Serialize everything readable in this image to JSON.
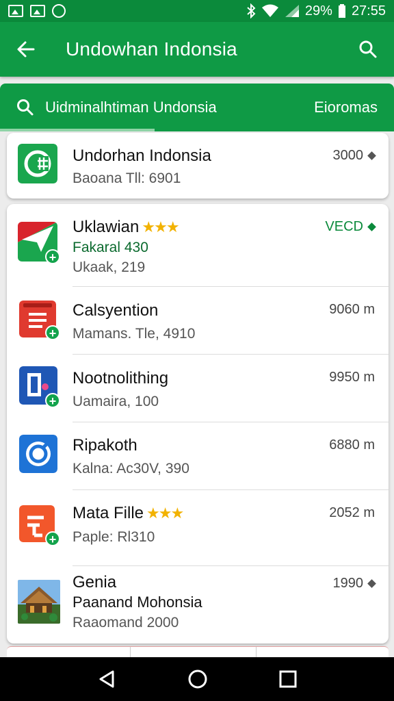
{
  "status_bar": {
    "battery_percent": "29%",
    "time": "27:55"
  },
  "app_bar": {
    "title": "Undowhan Indonsia"
  },
  "tabs": {
    "search_label": "Uidminalhtiman Undonsia",
    "right_label": "Eioromas"
  },
  "featured": {
    "title": "Undorhan Indonsia",
    "subtitle": "Baoana Tll: 6901",
    "value": "3000"
  },
  "items": [
    {
      "title": "Uklawian",
      "subtitle": "Fakaral 430",
      "subtitle2": "Ukaak, 219",
      "value": "VECD",
      "stars": "★★★"
    },
    {
      "title": "Calsyention",
      "subtitle": "Mamans. Tle, 4910",
      "value": "9060 m"
    },
    {
      "title": "Nootnolithing",
      "subtitle": "Uamaira, 100",
      "value": "9950 m"
    },
    {
      "title": "Ripakoth",
      "subtitle": "Kalna: Ac30V, 390",
      "value": "6880 m"
    },
    {
      "title": "Mata Fille",
      "subtitle": "Paple: Rl310",
      "value": "2052 m",
      "stars": "★★★"
    },
    {
      "title": "Genia",
      "subtitle": "Paanand Mohonsia",
      "subtitle2": "Raaomand 2000",
      "value": "1990"
    }
  ],
  "colors": {
    "primary": "#0f9a45",
    "primary_dark": "#0b8a3b",
    "accent_star": "#f2b200"
  }
}
